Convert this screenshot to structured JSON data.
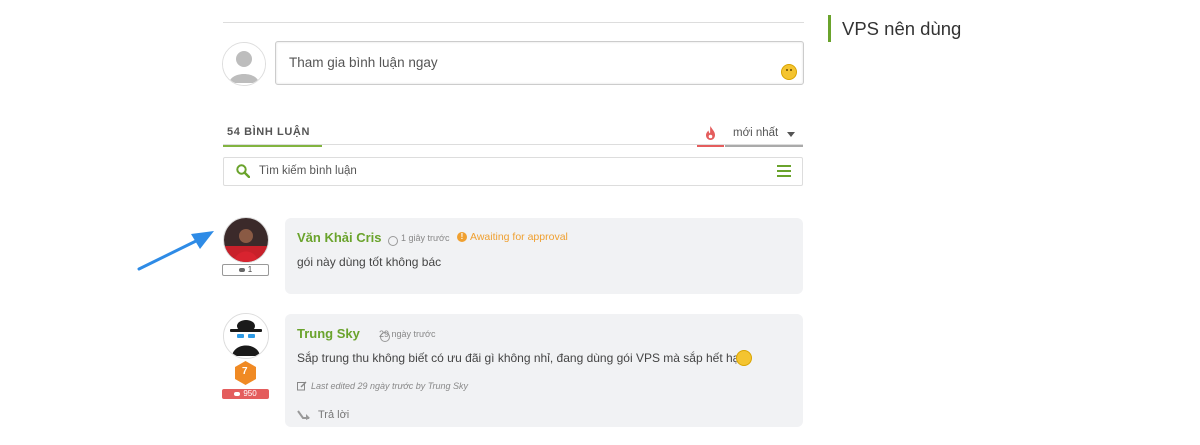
{
  "form": {
    "placeholder": "Tham gia bình luận ngay"
  },
  "header": {
    "comment_count_label": "54 BÌNH LUẬN",
    "sort_label": "mới nhất"
  },
  "search": {
    "placeholder": "Tìm kiếm bình luận"
  },
  "comments": [
    {
      "author": "Văn Khải Cris",
      "time": "1 giây trước",
      "status": "Awaiting for approval",
      "text": "gói này dùng tốt không bác",
      "badge_count": "1"
    },
    {
      "author": "Trung Sky",
      "time": "29 ngày trước",
      "text": "Sắp trung thu không biết có ưu đãi gì không nhỉ, đang dùng gói VPS mà sắp hết hạn",
      "edited": "Last edited 29 ngày trước by Trung Sky",
      "reply_label": "Trả lời",
      "badge_count": "950",
      "rank_badge": "7"
    }
  ],
  "sidebar": {
    "title": "VPS nên dùng"
  },
  "colors": {
    "accent_green": "#6aa32c",
    "hot_red": "#e45d5d",
    "pending_orange": "#f0a030",
    "arrow_blue": "#2e8be6"
  },
  "icons": [
    "emoji-icon",
    "fire-icon",
    "chevron-down-icon",
    "search-icon",
    "menu-icon",
    "clock-icon",
    "warning-icon",
    "comment-icon",
    "edit-icon",
    "reply-icon",
    "rank-icon",
    "arrow-annotation-icon"
  ]
}
